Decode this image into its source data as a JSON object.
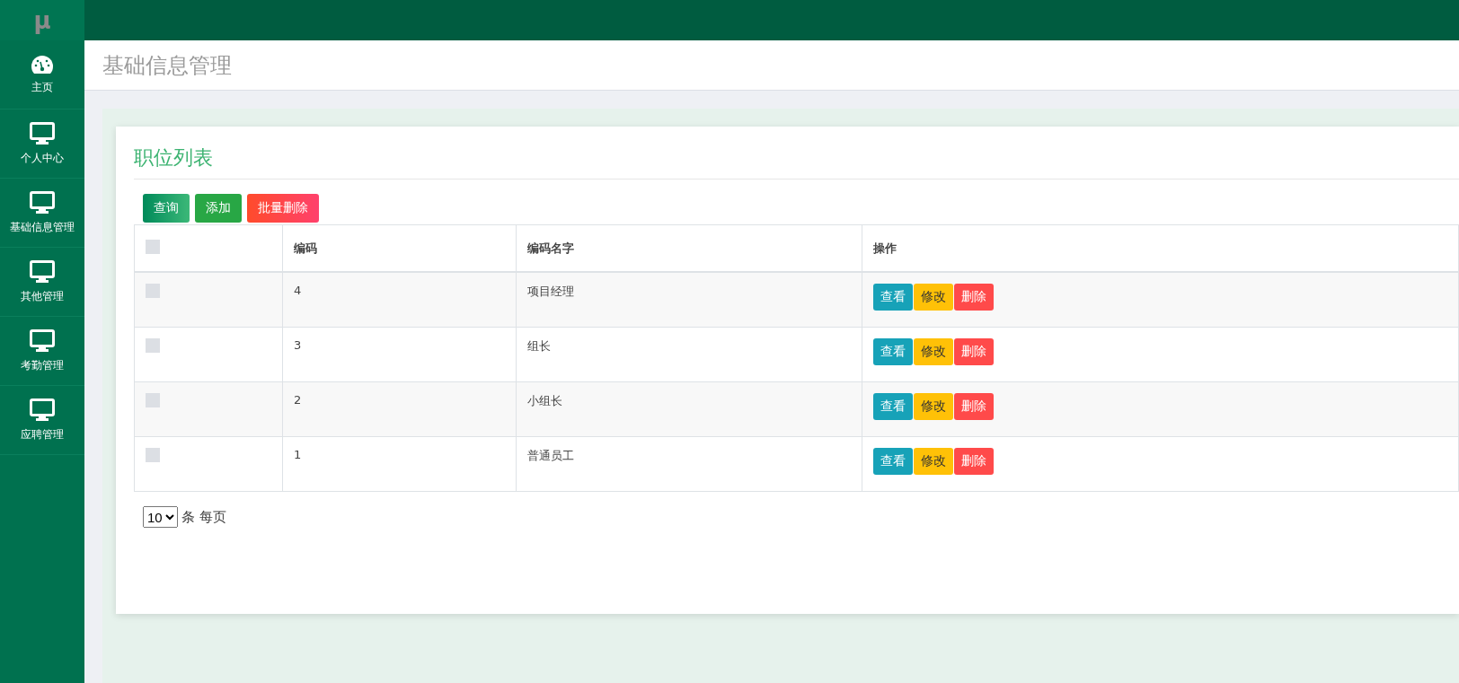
{
  "sidebar": {
    "logo": "μ",
    "items": [
      {
        "label": "主页",
        "kind": "dashboard"
      },
      {
        "label": "个人中心",
        "kind": "monitor"
      },
      {
        "label": "基础信息管理",
        "kind": "monitor"
      },
      {
        "label": "其他管理",
        "kind": "monitor"
      },
      {
        "label": "考勤管理",
        "kind": "monitor"
      },
      {
        "label": "应聘管理",
        "kind": "monitor"
      }
    ]
  },
  "page_title": "基础信息管理",
  "card": {
    "title": "职位列表",
    "toolbar": [
      {
        "label": "查询",
        "kind": "search"
      },
      {
        "label": "添加",
        "kind": "add"
      },
      {
        "label": "批量删除",
        "kind": "delete"
      }
    ],
    "table": {
      "header_checked": false,
      "columns": [
        "编码",
        "编码名字",
        "操作"
      ],
      "rows": [
        {
          "checked": false,
          "code": "4",
          "name": "项目经理",
          "actions": [
            {
              "label": "查看",
              "kind": "view"
            },
            {
              "label": "修改",
              "kind": "edit"
            },
            {
              "label": "删除",
              "kind": "delete"
            }
          ]
        },
        {
          "checked": false,
          "code": "3",
          "name": "组长",
          "actions": [
            {
              "label": "查看",
              "kind": "view"
            },
            {
              "label": "修改",
              "kind": "edit"
            },
            {
              "label": "删除",
              "kind": "delete"
            }
          ]
        },
        {
          "checked": false,
          "code": "2",
          "name": "小组长",
          "actions": [
            {
              "label": "查看",
              "kind": "view"
            },
            {
              "label": "修改",
              "kind": "edit"
            },
            {
              "label": "删除",
              "kind": "delete"
            }
          ]
        },
        {
          "checked": false,
          "code": "1",
          "name": "普通员工",
          "actions": [
            {
              "label": "查看",
              "kind": "view"
            },
            {
              "label": "修改",
              "kind": "edit"
            },
            {
              "label": "删除",
              "kind": "delete"
            }
          ]
        }
      ]
    },
    "pagination": {
      "page_size": "10",
      "suffix": "条 每页"
    }
  }
}
